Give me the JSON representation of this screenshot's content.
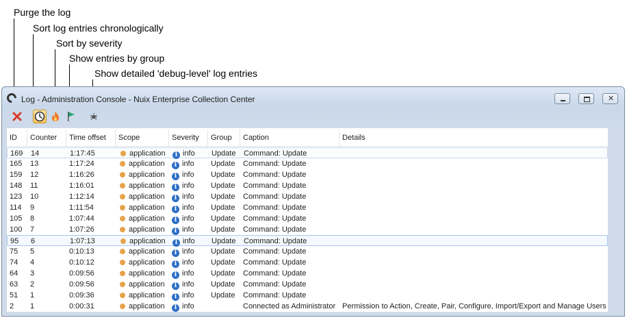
{
  "annotations": [
    {
      "name": "annotation-purge",
      "text": "Purge the log"
    },
    {
      "name": "annotation-sort-chronological",
      "text": "Sort log entries chronologically"
    },
    {
      "name": "annotation-sort-severity",
      "text": "Sort by severity"
    },
    {
      "name": "annotation-group",
      "text": "Show entries by group"
    },
    {
      "name": "annotation-debug",
      "text": "Show detailed 'debug-level' log entries"
    }
  ],
  "window": {
    "title": "Log - Administration Console - Nuix Enterprise Collection Center"
  },
  "toolbar": {
    "purge_icon": "close-x-icon",
    "chronological_icon": "clock-icon",
    "severity_icon": "flame-icon",
    "group_icon": "flag-icon",
    "debug_icon": "bug-icon"
  },
  "colors": {
    "purge": "#d93a2b",
    "scope_dot": "#e6a34a",
    "info": "#2e6fc6",
    "group_flag": "#2aa86f",
    "toolbar_active": "#f9c35f"
  },
  "table": {
    "columns": [
      "ID",
      "Counter",
      "Time offset",
      "Scope",
      "Severity",
      "Group",
      "Caption",
      "Details"
    ],
    "rows": [
      {
        "id": "169",
        "counter": "14",
        "time": "1:17:45",
        "scope": "application",
        "severity": "info",
        "group": "Update",
        "caption": "Command: Update",
        "details": ""
      },
      {
        "id": "165",
        "counter": "13",
        "time": "1:17:24",
        "scope": "application",
        "severity": "info",
        "group": "Update",
        "caption": "Command: Update",
        "details": ""
      },
      {
        "id": "159",
        "counter": "12",
        "time": "1:16:26",
        "scope": "application",
        "severity": "info",
        "group": "Update",
        "caption": "Command: Update",
        "details": ""
      },
      {
        "id": "148",
        "counter": "11",
        "time": "1:16:01",
        "scope": "application",
        "severity": "info",
        "group": "Update",
        "caption": "Command: Update",
        "details": ""
      },
      {
        "id": "123",
        "counter": "10",
        "time": "1:12:14",
        "scope": "application",
        "severity": "info",
        "group": "Update",
        "caption": "Command: Update",
        "details": ""
      },
      {
        "id": "114",
        "counter": "9",
        "time": "1:11:54",
        "scope": "application",
        "severity": "info",
        "group": "Update",
        "caption": "Command: Update",
        "details": ""
      },
      {
        "id": "105",
        "counter": "8",
        "time": "1:07:44",
        "scope": "application",
        "severity": "info",
        "group": "Update",
        "caption": "Command: Update",
        "details": ""
      },
      {
        "id": "100",
        "counter": "7",
        "time": "1:07:26",
        "scope": "application",
        "severity": "info",
        "group": "Update",
        "caption": "Command: Update",
        "details": ""
      },
      {
        "id": "95",
        "counter": "6",
        "time": "1:07:13",
        "scope": "application",
        "severity": "info",
        "group": "Update",
        "caption": "Command: Update",
        "details": ""
      },
      {
        "id": "75",
        "counter": "5",
        "time": "0:10:13",
        "scope": "application",
        "severity": "info",
        "group": "Update",
        "caption": "Command: Update",
        "details": ""
      },
      {
        "id": "74",
        "counter": "4",
        "time": "0:10:12",
        "scope": "application",
        "severity": "info",
        "group": "Update",
        "caption": "Command: Update",
        "details": ""
      },
      {
        "id": "64",
        "counter": "3",
        "time": "0:09:56",
        "scope": "application",
        "severity": "info",
        "group": "Update",
        "caption": "Command: Update",
        "details": ""
      },
      {
        "id": "63",
        "counter": "2",
        "time": "0:09:56",
        "scope": "application",
        "severity": "info",
        "group": "Update",
        "caption": "Command: Update",
        "details": ""
      },
      {
        "id": "51",
        "counter": "1",
        "time": "0:09:36",
        "scope": "application",
        "severity": "info",
        "group": "Update",
        "caption": "Command: Update",
        "details": ""
      },
      {
        "id": "2",
        "counter": "1",
        "time": "0:00:31",
        "scope": "application",
        "severity": "info",
        "group": "",
        "caption": "Connected as Administrator",
        "details": "Permission to Action, Create, Pair, Configure, Import/Export and Manage Users"
      }
    ]
  }
}
